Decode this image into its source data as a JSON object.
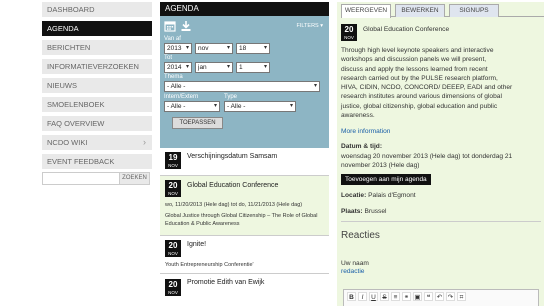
{
  "nav": {
    "items": [
      {
        "label": "Dashboard",
        "active": false
      },
      {
        "label": "Agenda",
        "active": true
      },
      {
        "label": "Berichten",
        "active": false
      },
      {
        "label": "Informatieverzoeken",
        "active": false
      },
      {
        "label": "Nieuws",
        "active": false
      },
      {
        "label": "Smoelenboek",
        "active": false
      },
      {
        "label": "FAQ Overview",
        "active": false
      },
      {
        "label": "NCDO Wiki",
        "active": false
      },
      {
        "label": "Event Feedback",
        "active": false
      }
    ],
    "search_button": "ZOEKEN"
  },
  "agenda": {
    "title": "AGENDA",
    "filters_label": "FILTERS ▾",
    "van_label": "Van af",
    "van": {
      "year": "2013",
      "month": "nov",
      "day": "18"
    },
    "tot_label": "Tot",
    "tot": {
      "year": "2014",
      "month": "jan",
      "day": "1"
    },
    "thema_label": "Thema",
    "thema_value": "- Alle -",
    "intern_label": "Intern/Extern",
    "intern_value": "- Alle -",
    "type_label": "Type",
    "type_value": "- Alle -",
    "apply_label": "TOEPASSEN"
  },
  "events": [
    {
      "day": "19",
      "month": "NOV",
      "title": "Verschijningsdatum Samsam",
      "lines": []
    },
    {
      "day": "20",
      "month": "NOV",
      "title": "Global Education Conference",
      "lines": [
        "wo, 11/20/2013 (Hele dag) tot do, 11/21/2013 (Hele dag)",
        "Global Justice through Global Citizenship – The Role of Global",
        "Education & Public Awareness"
      ]
    },
    {
      "day": "20",
      "month": "NOV",
      "title": "Ignite!",
      "lines": [
        "Youth Entrepreneurship Conferentie'"
      ]
    },
    {
      "day": "20",
      "month": "NOV",
      "title": "Promotie Edith van Ewijk",
      "lines": []
    }
  ],
  "detail": {
    "tabs": [
      "WEERGEVEN",
      "BEWERKEN",
      "SIGNUPS"
    ],
    "day": "20",
    "month": "NOV",
    "title": "Global Education Conference",
    "description": [
      "Through high level keynote speakers and interactive",
      "workshops and discussion panels we will present,",
      "discuss and apply the lessons learned from recent",
      "research carried out by the PULSE research platform,",
      "HIVA, CIDIN, NCDO, CONCORD/ DEEEP, EADI and other",
      "research institutes around various dimensions of global",
      "justice, global citizenship, global education and public",
      "awareness."
    ],
    "more_info": "More information",
    "date_label": "Datum & tijd:",
    "date_line1": "woensdag 20 november 2013 (Hele dag) tot donderdag 21",
    "date_line2": "november 2013 (Hele dag)",
    "add_button": "Toevoegen aan mijn agenda",
    "locatie_label": "Locatie:",
    "locatie_value": "Palais d'Egmont",
    "plaats_label": "Plaats:",
    "plaats_value": "Brussel",
    "reacties": "Reacties",
    "uw_naam": "Uw naam",
    "redactie": "redactie"
  },
  "colors": {
    "accent": "#111111",
    "filter_bg": "#8db5c4",
    "highlight": "#eef7e0",
    "link": "#1a5fa8"
  }
}
